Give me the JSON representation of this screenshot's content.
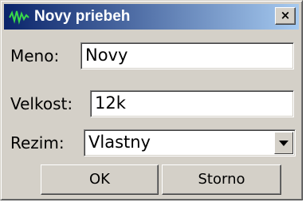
{
  "window": {
    "title": "Novy priebeh",
    "close_label": "×"
  },
  "form": {
    "name_label": "Meno:",
    "name_value": "Novy",
    "size_label": "Velkost:",
    "size_value": "12k",
    "mode_label": "Rezim:",
    "mode_value": "Vlastny"
  },
  "buttons": {
    "ok_label": "OK",
    "cancel_label": "Storno"
  },
  "icons": {
    "app": "waveform-icon",
    "close": "close-icon",
    "dropdown": "chevron-down-icon"
  },
  "colors": {
    "titlebar_start": "#0a246a",
    "titlebar_end": "#a6caf0",
    "dialog_face": "#d4d0c8",
    "waveform": "#39d94a"
  }
}
